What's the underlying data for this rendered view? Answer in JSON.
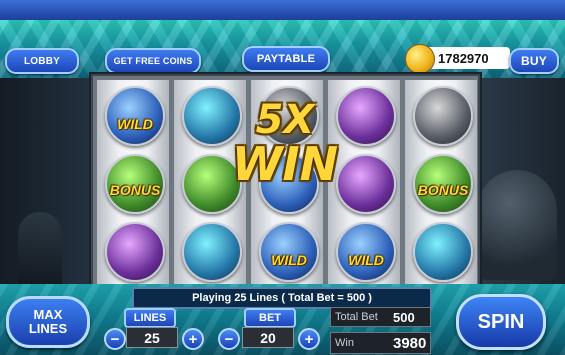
{
  "header": {
    "lobby_label": "LOBBY",
    "free_coins_label": "GET FREE COINS",
    "paytable_label": "PAYTABLE",
    "coin_balance": "1782970",
    "buy_label": "BUY"
  },
  "reels": {
    "symbol_labels": {
      "wild": "WILD",
      "bonus": "BONUS"
    }
  },
  "win_banner": {
    "multiplier": "5X",
    "text": "WIN"
  },
  "controls": {
    "status_text": "Playing 25 Lines ( Total Bet = 500 )",
    "max_lines_line1": "MAX",
    "max_lines_line2": "LINES",
    "lines_label": "LINES",
    "lines_value": "25",
    "bet_label": "BET",
    "bet_value": "20",
    "total_bet_label": "Total Bet",
    "total_bet_value": "500",
    "win_label": "Win",
    "win_value": "3980",
    "spin_label": "SPIN",
    "plus_symbol": "+",
    "minus_symbol": "−"
  }
}
